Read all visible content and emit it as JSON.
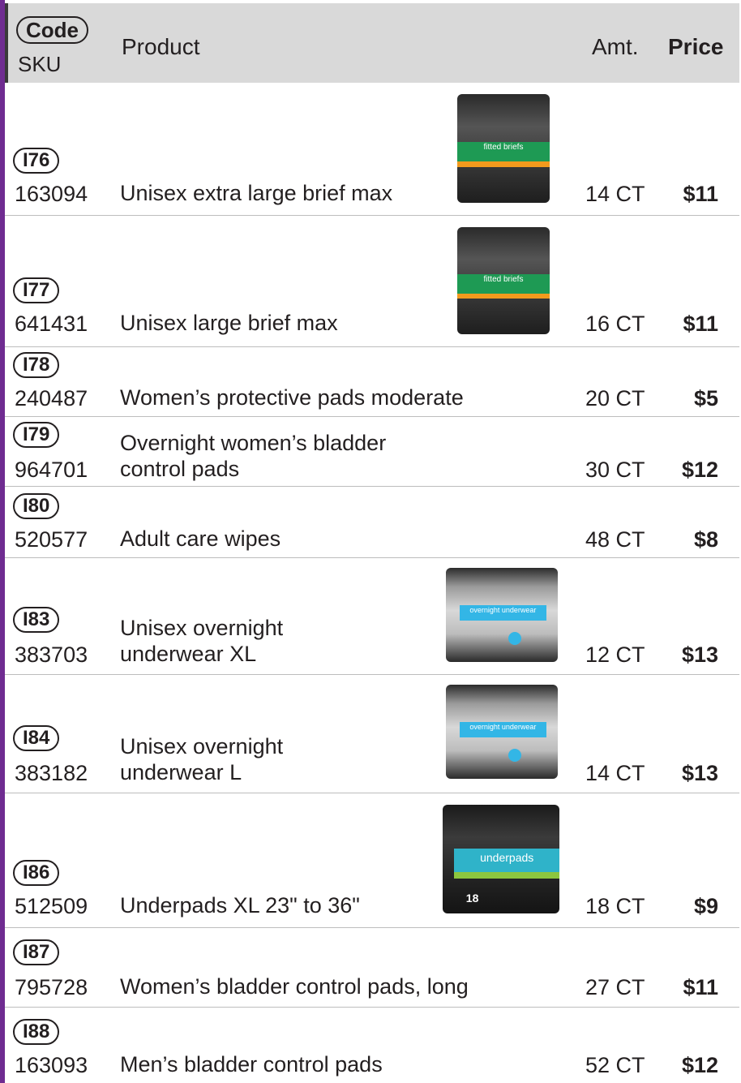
{
  "header": {
    "code_label": "Code",
    "sku_label": "SKU",
    "product_label": "Product",
    "amt_label": "Amt.",
    "price_label": "Price"
  },
  "rows": [
    {
      "code": "I76",
      "sku": "163094",
      "product": "Unisex extra large brief max",
      "amt": "14 CT",
      "price": "$11",
      "image": "fitted-briefs-package",
      "image_text": "fitted briefs"
    },
    {
      "code": "I77",
      "sku": "641431",
      "product": "Unisex large brief max",
      "amt": "16 CT",
      "price": "$11",
      "image": "fitted-briefs-package",
      "image_text": "fitted briefs"
    },
    {
      "code": "I78",
      "sku": "240487",
      "product": "Women’s protective pads moderate",
      "amt": "20 CT",
      "price": "$5"
    },
    {
      "code": "I79",
      "sku": "964701",
      "product_line1": "Overnight women’s bladder",
      "product_line2": "control pads",
      "amt": "30 CT",
      "price": "$12"
    },
    {
      "code": "I80",
      "sku": "520577",
      "product": "Adult care wipes",
      "amt": "48 CT",
      "price": "$8"
    },
    {
      "code": "I83",
      "sku": "383703",
      "product_line1": "Unisex overnight",
      "product_line2": "underwear XL",
      "amt": "12 CT",
      "price": "$13",
      "image": "overnight-underwear-package",
      "image_text": "overnight underwear"
    },
    {
      "code": "I84",
      "sku": "383182",
      "product_line1": "Unisex overnight",
      "product_line2": "underwear L",
      "amt": "14 CT",
      "price": "$13",
      "image": "overnight-underwear-package",
      "image_text": "overnight underwear"
    },
    {
      "code": "I86",
      "sku": "512509",
      "product": "Underpads XL 23\" to 36\"",
      "amt": "18 CT",
      "price": "$9",
      "image": "underpads-package",
      "image_text": "underpads",
      "image_count": "18"
    },
    {
      "code": "I87",
      "sku": "795728",
      "product": "Women’s bladder control pads, long",
      "amt": "27 CT",
      "price": "$11"
    },
    {
      "code": "I88",
      "sku": "163093",
      "product": "Men’s bladder control pads",
      "amt": "52 CT",
      "price": "$12"
    }
  ],
  "colors": {
    "accent_bar": "#6f2c91",
    "header_bg": "#d9d9d9",
    "text": "#231f20"
  }
}
